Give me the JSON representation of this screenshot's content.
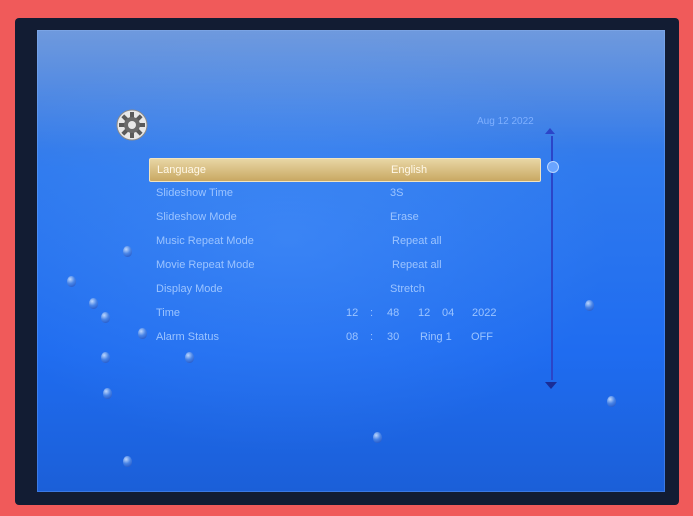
{
  "header": {
    "date_text": "Aug 12  2022"
  },
  "menu": {
    "items": [
      {
        "label": "Language",
        "value": "English"
      },
      {
        "label": "Slideshow Time",
        "value": "3S"
      },
      {
        "label": "Slideshow  Mode",
        "value": "Erase"
      },
      {
        "label": "Music Repeat Mode",
        "value": "Repeat all"
      },
      {
        "label": "Movie Repeat Mode",
        "value": "Repeat all"
      },
      {
        "label": "Display Mode",
        "value": "Stretch"
      },
      {
        "label": "Time",
        "hour": "12",
        "sep": ":",
        "minute": "48",
        "month": "12",
        "day": "04",
        "year": "2022"
      },
      {
        "label": "Alarm Status",
        "hour": "08",
        "sep": ":",
        "minute": "30",
        "ring": "Ring 1",
        "state": "OFF"
      }
    ]
  },
  "colors": {
    "screen_blue": "#1f6cf0",
    "selection_gold": "#c9a862",
    "text_blue": "#9cc4ff",
    "surround_red": "#f05a5a"
  },
  "icons": {
    "settings": "gear-icon",
    "scroll_up": "triangle-up-icon",
    "scroll_down": "triangle-down-icon"
  }
}
